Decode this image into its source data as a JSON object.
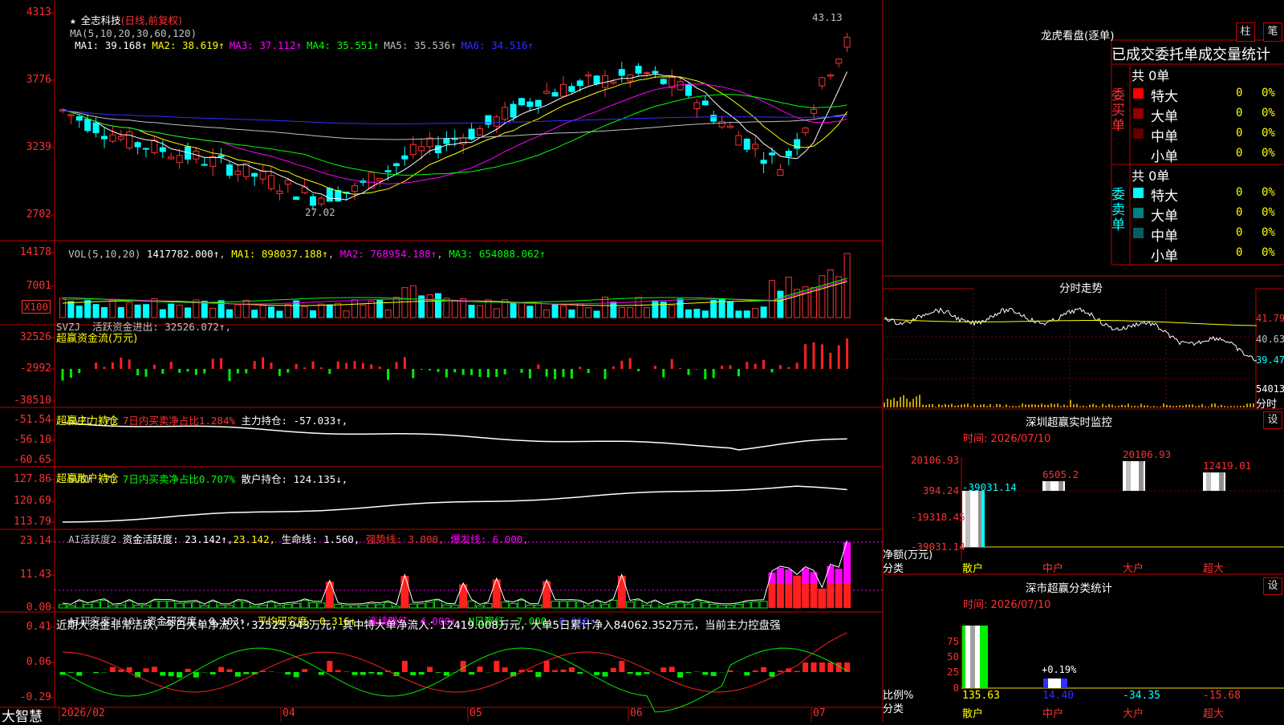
{
  "stock": {
    "name": "全志科技",
    "mode": "(日线,前复权)",
    "star": "★"
  },
  "kline": {
    "ma_title": "MA(5,10,20,30,60,120)",
    "ma": [
      {
        "label": "MA1: 39.168↑",
        "color": "#ffffff"
      },
      {
        "label": "MA2: 38.619↑",
        "color": "#ffff00"
      },
      {
        "label": "MA3: 37.112↑",
        "color": "#ff00ff"
      },
      {
        "label": "MA4: 35.551↑",
        "color": "#00ff00"
      },
      {
        "label": "MA5: 35.536↑",
        "color": "#c0c0c0"
      },
      {
        "label": "MA6: 34.516↑",
        "color": "#3030ff"
      }
    ],
    "y_ticks": [
      "4313",
      "3776",
      "3239",
      "2702"
    ],
    "high_label": "43.13",
    "low_label": "27.02"
  },
  "vol": {
    "header": "VOL(5,10,20)",
    "value": "1417782.000↑",
    "ma1": "MA1: 898037.188↑",
    "ma2": "MA2: 768954.188↑",
    "ma3": "MA3: 654088.062↑",
    "y_ticks": [
      "14178",
      "7001"
    ],
    "unit": "X100"
  },
  "svzj": {
    "header": "SVZJ  活跃资金进出: 32526.072↑,",
    "sub": "超赢资金流(万元)",
    "y_ticks": [
      "32526",
      "-2992",
      "-38510"
    ]
  },
  "svzl": {
    "name": "SVZL (7)",
    "part1": "7日内买卖净占比1.284%",
    "part2": "主力持仓: -57.033↑,",
    "sub": "超赢主力持仓",
    "y_ticks": [
      "-51.54",
      "-56.10",
      "-60.65"
    ]
  },
  "svsh": {
    "name": "SVSH (7)",
    "part1": "7日内买卖净占比0.707%",
    "part2": "散户持仓: 124.135↓,",
    "sub": "超赢散户持仓",
    "y_ticks": [
      "127.86",
      "120.69",
      "113.79"
    ]
  },
  "ai_active": {
    "a": "AI活跃度2",
    "b": "资金活跃度: 23.142↑,",
    "c": "23.142,",
    "d": "生命线: 1.560,",
    "e": "强势线: 3.000,",
    "f": "爆发线: 6.000,",
    "y_ticks": [
      "23.14",
      "11.43",
      "0.00"
    ]
  },
  "ai_research": {
    "a": "AI研究度2(10)",
    "b": "资金研究度: 0.103↑,",
    "c": "平均研究度: 0.316↑,",
    "d": "连续飘红: 4.000↑,",
    "e": "N日飘红: 7.000,",
    "f": "0.316↑,",
    "note": "近期大资金非常活跃，今日大单净流入：32525.943万元，其中特大单净流入：12419.008万元，大单5日累计净入84062.352万元，当前主力控盘强",
    "y_ticks": [
      "0.41",
      "0.06",
      "-0.29"
    ]
  },
  "footer": {
    "brand": "大智慧",
    "dates": [
      "2026/02",
      "04",
      "05",
      "06",
      "07"
    ]
  },
  "right": {
    "title": "龙虎看盘(逐单)",
    "tab_bar": "柱",
    "tab_tick": "笔",
    "header": "已成交委托单成交量统计",
    "buy": {
      "side": "委买单",
      "total": "共 0单",
      "rows": [
        {
          "label": "特大",
          "n": "0",
          "pct": "0%",
          "color": "#ff0000"
        },
        {
          "label": "大单",
          "n": "0",
          "pct": "0%",
          "color": "#900000"
        },
        {
          "label": "中单",
          "n": "0",
          "pct": "0%",
          "color": "#600000"
        },
        {
          "label": "小单",
          "n": "0",
          "pct": "0%",
          "color": "#000000"
        }
      ]
    },
    "sell": {
      "side": "委卖单",
      "total": "共 0单",
      "rows": [
        {
          "label": "特大",
          "n": "0",
          "pct": "0%",
          "color": "#00ffff"
        },
        {
          "label": "大单",
          "n": "0",
          "pct": "0%",
          "color": "#008080"
        },
        {
          "label": "中单",
          "n": "0",
          "pct": "0%",
          "color": "#006060"
        },
        {
          "label": "小单",
          "n": "0",
          "pct": "0%",
          "color": "#000000"
        }
      ]
    },
    "intraday": {
      "title": "分时走势",
      "prices": [
        "41.79",
        "40.63",
        "39.47"
      ],
      "vol": "54013",
      "vol_label": "分时"
    },
    "monitor": {
      "title": "深圳超赢实时监控",
      "settings": "设",
      "time": "时间: 2026/07/10",
      "y_ticks": [
        "20106.93",
        "394.24",
        "-19318.45",
        "-39031.14"
      ],
      "y_label": "净额(万元)",
      "x_label": "分类",
      "cats": [
        "散户",
        "中户",
        "大户",
        "超大"
      ],
      "values": [
        -39031.14,
        6505.2,
        20106.93,
        12419.01
      ],
      "value_labels": [
        "-39031.14",
        "6505.2",
        "20106.93",
        "12419.01"
      ]
    },
    "stats": {
      "title": "深市超赢分类统计",
      "settings": "设",
      "time": "时间: 2026/07/10",
      "y_ticks": [
        "75",
        "50",
        "25",
        "0"
      ],
      "y_label": "比例%",
      "x_label": "分类",
      "cats": [
        "散户",
        "中户",
        "大户",
        "超大"
      ],
      "values": [
        "135.63",
        "14.40",
        "-34.35",
        "-15.68"
      ],
      "annot": "+0.19%"
    }
  },
  "chart_data": [
    {
      "type": "candlestick",
      "title": "全志科技(日线,前复权)",
      "y_ticks": [
        4313,
        3776,
        3239,
        2702
      ],
      "annotations": {
        "high": 43.13,
        "low": 27.02
      },
      "x_ticks": [
        "2026/02",
        "04",
        "05",
        "06",
        "07"
      ]
    },
    {
      "type": "bar",
      "title": "VOL(5,10,20)",
      "latest": 1417782.0,
      "ma": [
        898037.188,
        768954.188,
        654088.062
      ],
      "y_ticks": [
        14178,
        7001
      ]
    },
    {
      "type": "bar",
      "title": "超赢实时监控 净额(万元)",
      "categories": [
        "散户",
        "中户",
        "大户",
        "超大"
      ],
      "values": [
        -39031.14,
        6505.2,
        20106.93,
        12419.01
      ]
    },
    {
      "type": "bar",
      "title": "超赢分类统计 比例%",
      "categories": [
        "散户",
        "中户",
        "大户",
        "超大"
      ],
      "values": [
        135.63,
        14.4,
        -34.35,
        -15.68
      ]
    }
  ]
}
